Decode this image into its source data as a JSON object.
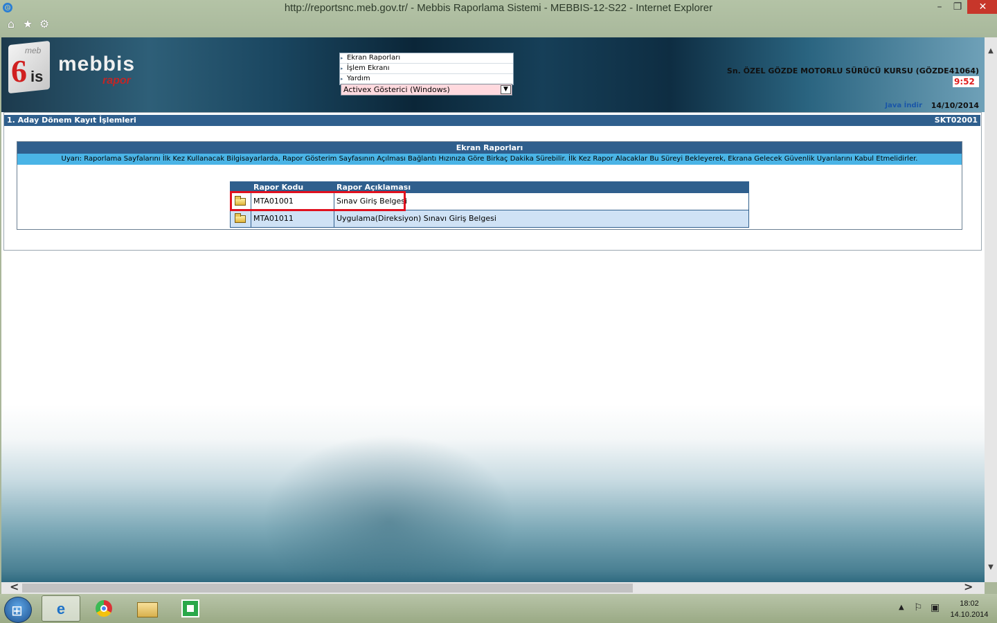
{
  "window": {
    "title": "http://reportsnc.meb.gov.tr/ - Mebbis Raporlama Sistemi - MEBBIS-12-S22 - Internet Explorer",
    "min_label": "–",
    "max_label": "❐",
    "close_label": "✕"
  },
  "toolbar": {
    "home_icon": "home-icon",
    "favorites_icon": "star-icon",
    "settings_icon": "gear-icon",
    "home_glyph": "⌂",
    "star_glyph": "★",
    "gear_glyph": "⚙"
  },
  "logo": {
    "six": "6",
    "is": "is",
    "meb": "meb",
    "mebbis": "mebbis",
    "rapor": "rapor"
  },
  "menu": {
    "items": [
      {
        "label": "Ekran Raporları"
      },
      {
        "label": "İşlem Ekranı"
      },
      {
        "label": "Yardım"
      }
    ],
    "viewer_select": "Activex Gösterici (Windows)",
    "select_arrow": "▼"
  },
  "user": {
    "name": "Sn. ÖZEL GÖZDE MOTORLU SÜRÜCÜ KURSU (GÖZDE41064)",
    "clock": "9:52",
    "java_link": "Java İndir",
    "date": "14/10/2014"
  },
  "section": {
    "title": "1. Aday Dönem Kayıt İşlemleri",
    "code": "SKT02001"
  },
  "panel": {
    "title": "Ekran Raporları",
    "warning": "Uyarı: Raporlama Sayfalarını İlk Kez Kullanacak Bilgisayarlarda, Rapor Gösterim Sayfasının Açılması Bağlantı Hızınıza Göre Birkaç Dakika Sürebilir. İlk Kez Rapor Alacaklar Bu Süreyi Bekleyerek, Ekrana Gelecek Güvenlik Uyarılarını Kabul Etmelidirler."
  },
  "report_table": {
    "headers": [
      "",
      "Rapor Kodu",
      "Rapor Açıklaması"
    ],
    "rows": [
      {
        "code": "MTA01001",
        "description": "Sınav Giriş Belgesi"
      },
      {
        "code": "MTA01011",
        "description": "Uygulama(Direksiyon) Sınavı Giriş Belgesi"
      }
    ]
  },
  "scrollbar": {
    "left": "<",
    "right": ">",
    "up": "▲",
    "down": "▼"
  },
  "taskbar": {
    "start_glyph": "⊞",
    "ie_glyph": "e",
    "tray_up": "▲",
    "tray_flag": "⚐",
    "tray_net": "▣",
    "time": "18:02",
    "date": "14.10.2014"
  },
  "colors": {
    "header_blue": "#2f5f8d",
    "warning_blue": "#4ab4e6",
    "highlight_red": "#e0101e",
    "clock_red": "#e01e1e",
    "select_pink": "#ffd9de"
  }
}
